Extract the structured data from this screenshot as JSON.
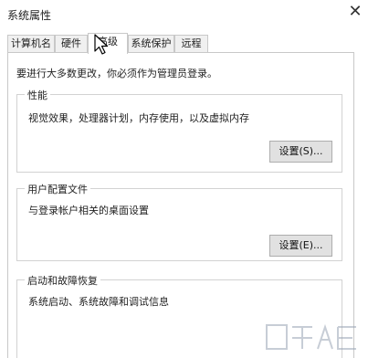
{
  "window": {
    "title": "系统属性",
    "close_glyph": "✕"
  },
  "tabs": [
    {
      "label": "计算机名",
      "active": false
    },
    {
      "label": "硬件",
      "active": false
    },
    {
      "label": "高级",
      "active": true
    },
    {
      "label": "系统保护",
      "active": false
    },
    {
      "label": "远程",
      "active": false
    }
  ],
  "advanced": {
    "admin_note": "要进行大多数更改，你必须作为管理员登录。",
    "performance": {
      "label": "性能",
      "description": "视觉效果，处理器计划，内存使用，以及虚拟内存",
      "button": "设置(S)..."
    },
    "user_profiles": {
      "label": "用户配置文件",
      "description": "与登录帐户相关的桌面设置",
      "button": "设置(E)..."
    },
    "startup_recovery": {
      "label": "启动和故障恢复",
      "description": "系统启动、系统故障和调试信息"
    }
  },
  "cursor": {
    "icon": "mouse-pointer-icon"
  },
  "colors": {
    "panel_border": "#c8c8c8",
    "button_face": "#e1e1e1",
    "button_border": "#adadad",
    "tab_inactive": "#f0f0f0"
  }
}
